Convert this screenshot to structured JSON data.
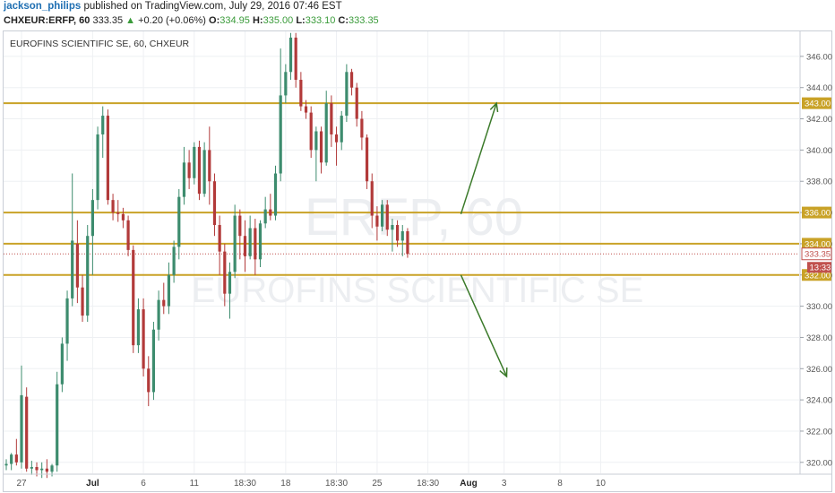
{
  "header": {
    "author": "jackson_philips",
    "published_text": "published on TradingView.com, July 29, 2016 07:46 EST"
  },
  "ohlc": {
    "symbol": "CHXEUR:ERFP, 60",
    "last": "333.35",
    "change": "+0.20 (+0.06%)",
    "o_label": "O:",
    "o": "334.95",
    "h_label": "H:",
    "h": "335.00",
    "l_label": "L:",
    "l": "333.10",
    "c_label": "C:",
    "c": "333.35"
  },
  "chart_data": {
    "type": "candlestick",
    "title": "EUROFINS SCIENTIFIC SE, 60, CHXEUR",
    "watermark": [
      "ERFP, 60",
      "EUROFINS SCIENTIFIC SE"
    ],
    "ylim": [
      319.3,
      347.6
    ],
    "y_ticks": [
      320,
      322,
      324,
      326,
      328,
      330,
      332,
      334,
      336,
      338,
      340,
      342,
      344,
      346
    ],
    "x_ticks": [
      {
        "label": "27",
        "bar": 3
      },
      {
        "label": "Jul",
        "bar": 17,
        "bold": true
      },
      {
        "label": "6",
        "bar": 27
      },
      {
        "label": "11",
        "bar": 37
      },
      {
        "label": "18:30",
        "bar": 47
      },
      {
        "label": "18",
        "bar": 55
      },
      {
        "label": "18:30",
        "bar": 65
      },
      {
        "label": "25",
        "bar": 73
      },
      {
        "label": "18:30",
        "bar": 83
      },
      {
        "label": "Aug",
        "bar": 91,
        "bold": true
      },
      {
        "label": "3",
        "bar": 98
      },
      {
        "label": "8",
        "bar": 109
      },
      {
        "label": "10",
        "bar": 117
      }
    ],
    "horizontal_levels": [
      343.0,
      336.0,
      334.0,
      332.0
    ],
    "level_color": "#c9a227",
    "last_price": 333.35,
    "countdown": "13:33",
    "up_color": "#3d8c6e",
    "down_color": "#b23a3a",
    "arrows": [
      {
        "from": [
          89.5,
          335.9
        ],
        "to": [
          96.5,
          343.0
        ]
      },
      {
        "from": [
          89.5,
          332.0
        ],
        "to": [
          98.5,
          325.5
        ]
      }
    ],
    "candles": [
      [
        319.8,
        320.2,
        319.5,
        319.9
      ],
      [
        319.9,
        320.6,
        319.5,
        320.5
      ],
      [
        320.5,
        321.5,
        319.8,
        320.0
      ],
      [
        320.0,
        326.2,
        319.6,
        324.3
      ],
      [
        324.2,
        324.8,
        319.4,
        319.6
      ],
      [
        319.6,
        320.1,
        319.2,
        319.7
      ],
      [
        319.7,
        320.0,
        319.1,
        319.5
      ],
      [
        319.5,
        320.0,
        319.0,
        319.6
      ],
      [
        319.6,
        320.2,
        319.0,
        319.4
      ],
      [
        319.4,
        319.9,
        319.1,
        319.8
      ],
      [
        319.8,
        325.8,
        319.4,
        325.0
      ],
      [
        325.0,
        328.0,
        324.5,
        327.6
      ],
      [
        327.6,
        331.0,
        326.5,
        330.5
      ],
      [
        330.5,
        338.5,
        330.0,
        334.2
      ],
      [
        334.0,
        335.5,
        330.2,
        331.2
      ],
      [
        331.2,
        332.0,
        329.0,
        329.4
      ],
      [
        329.4,
        335.2,
        329.0,
        334.5
      ],
      [
        334.5,
        337.5,
        332.0,
        336.8
      ],
      [
        336.8,
        341.5,
        336.2,
        341.0
      ],
      [
        341.0,
        342.8,
        339.5,
        342.2
      ],
      [
        342.2,
        342.6,
        336.5,
        336.8
      ],
      [
        336.8,
        337.2,
        335.5,
        336.0
      ],
      [
        336.0,
        336.8,
        335.4,
        335.9
      ],
      [
        335.9,
        336.3,
        335.0,
        335.5
      ],
      [
        335.5,
        335.8,
        333.2,
        333.6
      ],
      [
        333.6,
        333.9,
        327.0,
        327.5
      ],
      [
        327.5,
        330.5,
        327.0,
        329.8
      ],
      [
        329.8,
        330.5,
        325.5,
        326.0
      ],
      [
        326.0,
        326.8,
        323.6,
        324.5
      ],
      [
        324.5,
        329.0,
        324.0,
        328.5
      ],
      [
        328.5,
        331.0,
        327.8,
        330.4
      ],
      [
        330.4,
        331.5,
        329.5,
        330.0
      ],
      [
        330.0,
        332.8,
        329.5,
        332.0
      ],
      [
        332.0,
        334.2,
        331.5,
        333.8
      ],
      [
        333.8,
        337.5,
        333.0,
        337.0
      ],
      [
        337.0,
        340.2,
        336.5,
        339.2
      ],
      [
        339.2,
        340.0,
        337.5,
        338.2
      ],
      [
        338.2,
        340.5,
        337.8,
        340.2
      ],
      [
        340.2,
        340.6,
        336.8,
        337.2
      ],
      [
        337.2,
        340.5,
        337.0,
        340.0
      ],
      [
        340.0,
        341.5,
        336.5,
        338.0
      ],
      [
        338.0,
        338.5,
        334.5,
        335.2
      ],
      [
        335.2,
        335.8,
        332.0,
        333.5
      ],
      [
        333.5,
        334.0,
        330.0,
        330.8
      ],
      [
        330.8,
        332.8,
        329.2,
        332.2
      ],
      [
        332.2,
        336.5,
        331.8,
        335.8
      ],
      [
        335.8,
        336.2,
        333.0,
        334.5
      ],
      [
        334.5,
        335.5,
        332.2,
        333.2
      ],
      [
        333.2,
        335.8,
        333.0,
        335.0
      ],
      [
        335.0,
        335.6,
        332.0,
        333.0
      ],
      [
        333.0,
        335.5,
        332.5,
        335.3
      ],
      [
        335.3,
        337.0,
        335.0,
        336.2
      ],
      [
        336.2,
        337.2,
        335.5,
        335.8
      ],
      [
        335.8,
        339.0,
        335.5,
        338.5
      ],
      [
        338.5,
        346.5,
        338.0,
        343.5
      ],
      [
        343.5,
        345.5,
        343.0,
        345.0
      ],
      [
        345.0,
        347.5,
        344.5,
        347.2
      ],
      [
        347.2,
        347.5,
        344.0,
        344.5
      ],
      [
        344.5,
        345.0,
        342.5,
        342.8
      ],
      [
        342.8,
        343.2,
        342.0,
        342.4
      ],
      [
        342.4,
        342.8,
        339.5,
        340.0
      ],
      [
        340.0,
        341.5,
        338.0,
        341.2
      ],
      [
        341.2,
        341.5,
        338.5,
        339.2
      ],
      [
        339.2,
        343.8,
        339.0,
        343.0
      ],
      [
        343.0,
        343.5,
        340.2,
        341.0
      ],
      [
        341.0,
        341.5,
        339.0,
        340.5
      ],
      [
        340.5,
        342.5,
        340.0,
        342.2
      ],
      [
        342.2,
        345.5,
        341.8,
        345.0
      ],
      [
        345.0,
        345.2,
        343.5,
        344.0
      ],
      [
        344.0,
        344.3,
        341.5,
        342.0
      ],
      [
        342.0,
        342.5,
        340.0,
        340.8
      ],
      [
        340.8,
        341.0,
        337.5,
        338.0
      ],
      [
        338.0,
        338.5,
        335.0,
        335.8
      ],
      [
        335.8,
        336.4,
        334.2,
        335.1
      ],
      [
        335.1,
        336.8,
        334.8,
        336.5
      ],
      [
        336.5,
        336.8,
        334.5,
        334.9
      ],
      [
        334.9,
        335.6,
        333.5,
        335.2
      ],
      [
        335.2,
        335.5,
        333.8,
        334.2
      ],
      [
        334.2,
        335.2,
        333.2,
        334.8
      ],
      [
        334.8,
        335.0,
        333.1,
        333.35
      ]
    ]
  }
}
